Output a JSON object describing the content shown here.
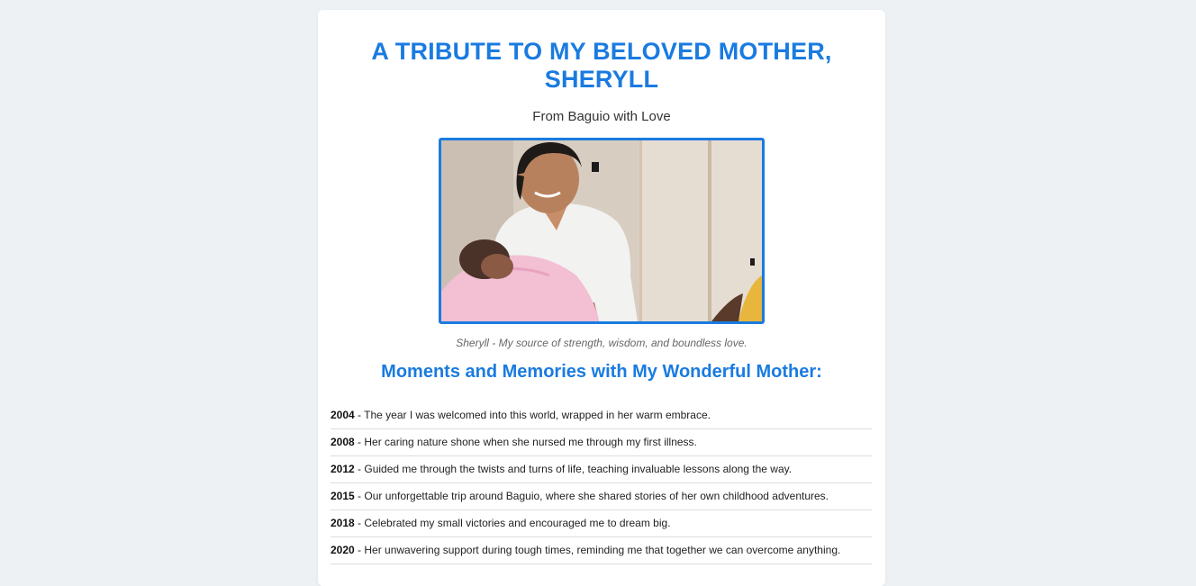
{
  "page": {
    "title": "A TRIBUTE TO MY BELOVED MOTHER, SHERYLL",
    "subtitle": "From Baguio with Love",
    "caption": "Sheryll - My source of strength, wisdom, and boundless love.",
    "section_heading": "Moments and Memories with My Wonderful Mother:"
  },
  "timeline": [
    {
      "year": "2004",
      "text": " - The year I was welcomed into this world, wrapped in her warm embrace."
    },
    {
      "year": "2008",
      "text": " - Her caring nature shone when she nursed me through my first illness."
    },
    {
      "year": "2012",
      "text": " - Guided me through the twists and turns of life, teaching invaluable lessons along the way."
    },
    {
      "year": "2015",
      "text": " - Our unforgettable trip around Baguio, where she shared stories of her own childhood adventures."
    },
    {
      "year": "2018",
      "text": " - Celebrated my small victories and encouraged me to dream big."
    },
    {
      "year": "2020",
      "text": " - Her unwavering support during tough times, reminding me that together we can overcome anything."
    }
  ],
  "colors": {
    "accent": "#1a7be0",
    "background": "#eef1f4",
    "card": "#ffffff"
  }
}
